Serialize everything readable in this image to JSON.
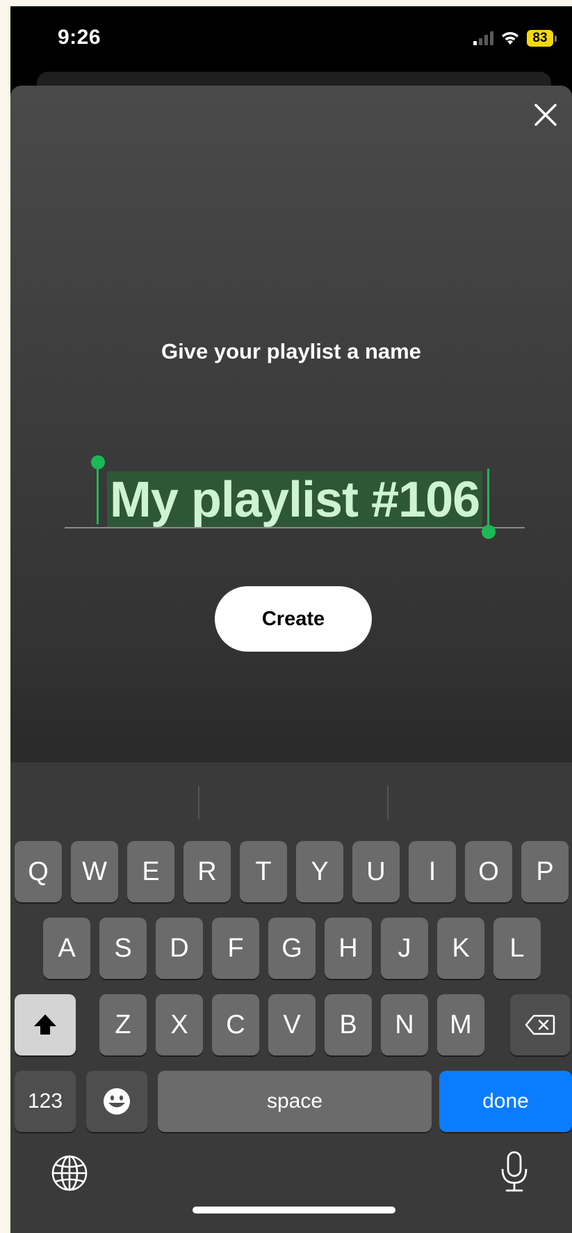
{
  "status_bar": {
    "time": "9:26",
    "battery": "83"
  },
  "dialog": {
    "prompt": "Give your playlist a name",
    "playlist_name": "My playlist #106",
    "create_label": "Create",
    "close_icon": "close-icon"
  },
  "keyboard": {
    "row1": [
      "Q",
      "W",
      "E",
      "R",
      "T",
      "Y",
      "U",
      "I",
      "O",
      "P"
    ],
    "row2": [
      "A",
      "S",
      "D",
      "F",
      "G",
      "H",
      "J",
      "K",
      "L"
    ],
    "row3": [
      "Z",
      "X",
      "C",
      "V",
      "B",
      "N",
      "M"
    ],
    "numbers_label": "123",
    "space_label": "space",
    "done_label": "done",
    "icons": [
      "shift-icon",
      "backspace-icon",
      "emoji-icon",
      "globe-icon",
      "microphone-icon"
    ],
    "accent_color": "#0a7cff"
  },
  "colors": {
    "selection_highlight": "#2e5737",
    "selection_handle": "#1db954",
    "battery": "#f5d90a"
  }
}
